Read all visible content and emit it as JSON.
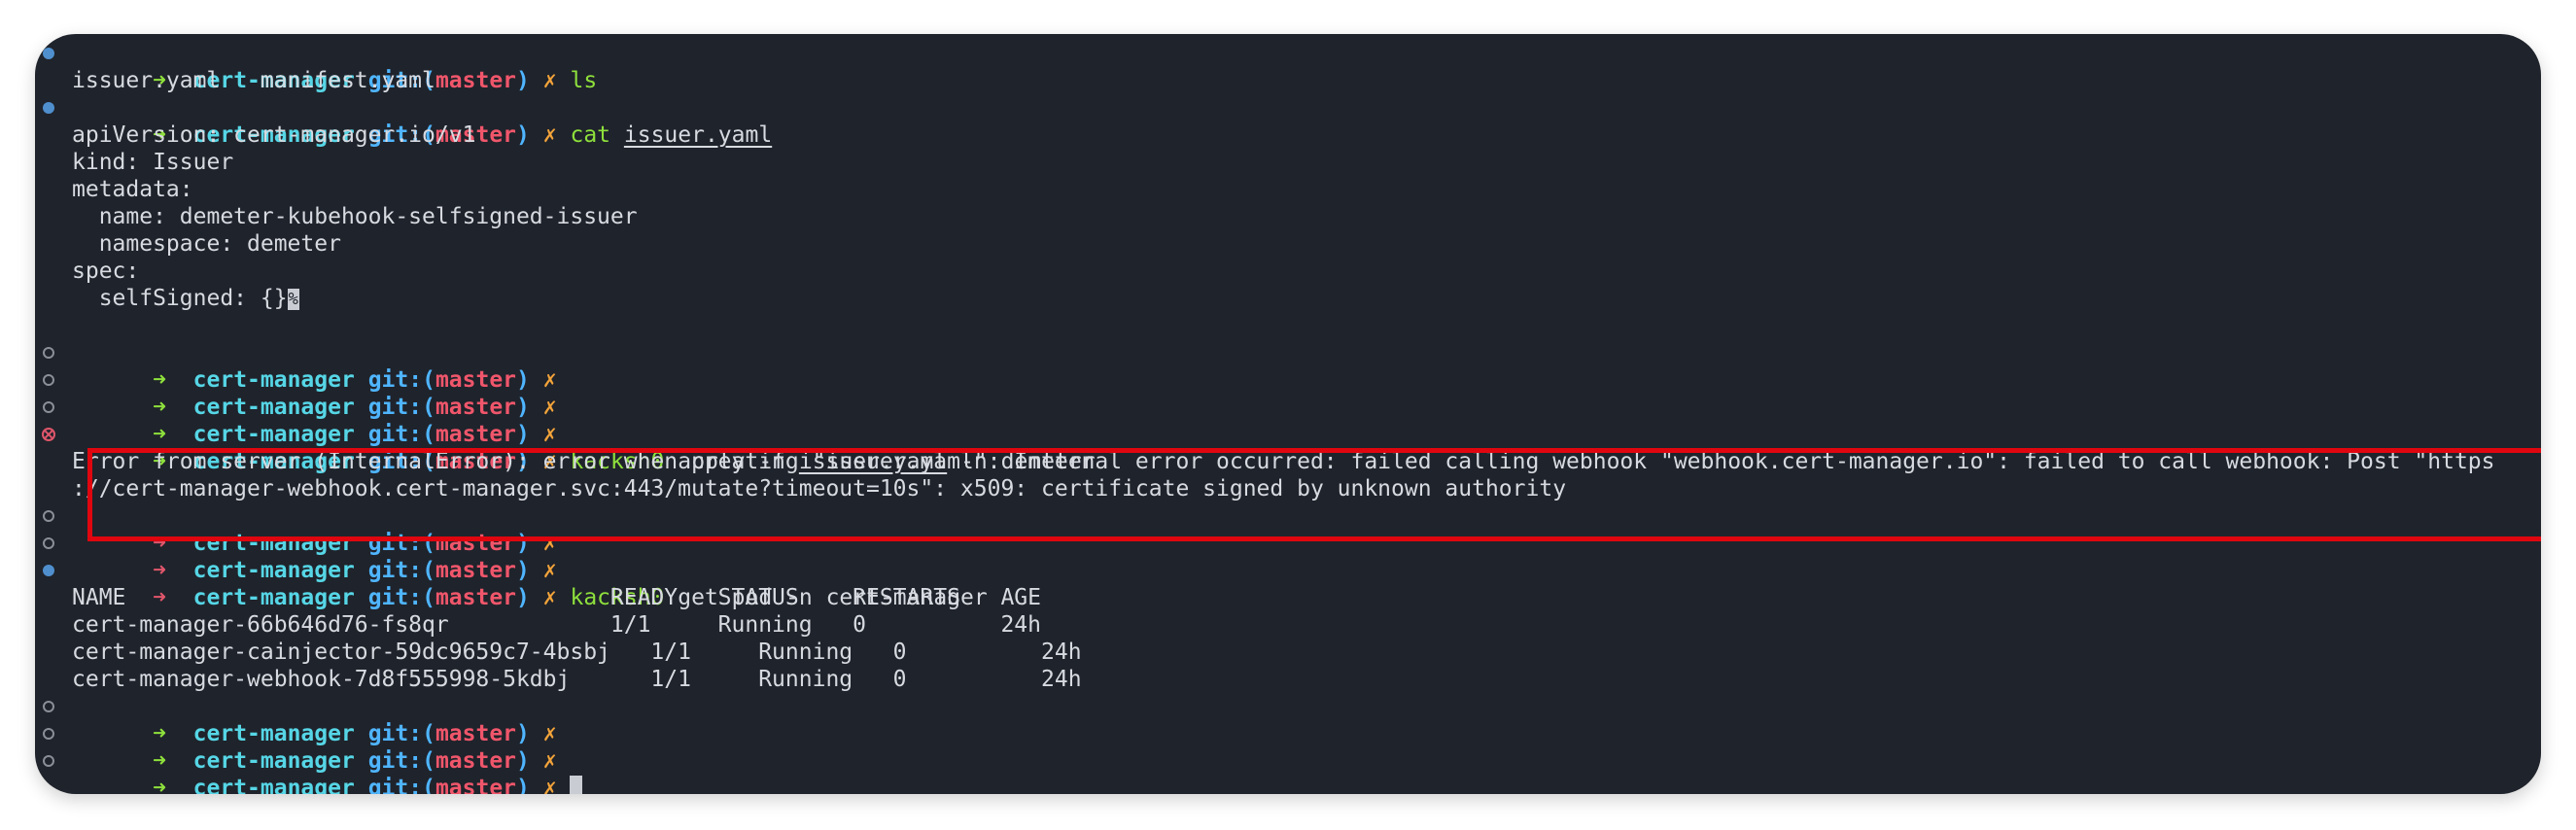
{
  "prompt": {
    "arrow": "➜",
    "dir": "cert-manager",
    "git": "git:(",
    "branch": "master",
    "git_close": ")",
    "dirty": "✗"
  },
  "commands": {
    "ls": "ls",
    "cat": "cat",
    "cat_arg": "issuer.yaml",
    "apply_cmd": "kacksh0",
    "apply_pre": " apply -f ",
    "apply_file": "issuer.yaml",
    "apply_post": " -n demeter",
    "get_cmd": "kacksh0",
    "get_args": " get pod -n cert-manager"
  },
  "output": {
    "ls_line": "issuer.yaml   manifest.yaml",
    "yaml": [
      "apiVersion: cert-manager.io/v1",
      "kind: Issuer",
      "metadata:",
      "  name: demeter-kubehook-selfsigned-issuer",
      "  namespace: demeter",
      "spec:",
      "  selfSigned: {}"
    ],
    "eol_marker": "%",
    "error_line1": "Error from server (InternalError): error when creating \"issuer.yaml\": Internal error occurred: failed calling webhook \"webhook.cert-manager.io\": failed to call webhook: Post \"https",
    "error_line2": "://cert-manager-webhook.cert-manager.svc:443/mutate?timeout=10s\": x509: certificate signed by unknown authority",
    "table_header": "NAME                                    READY   STATUS    RESTARTS   AGE",
    "table_rows": [
      "cert-manager-66b646d76-fs8qr            1/1     Running   0          24h",
      "cert-manager-cainjector-59dc9659c7-4bsbj   1/1     Running   0          24h",
      "cert-manager-webhook-7d8f555998-5kdbj      1/1     Running   0          24h"
    ]
  },
  "colors": {
    "background": "#1f232b",
    "arrow_ok": "#8ee03c",
    "arrow_err": "#e0566b",
    "dir": "#56d6e6",
    "branch": "#f0566b",
    "dirty": "#f2a33a",
    "highlight": "#e0060f"
  }
}
